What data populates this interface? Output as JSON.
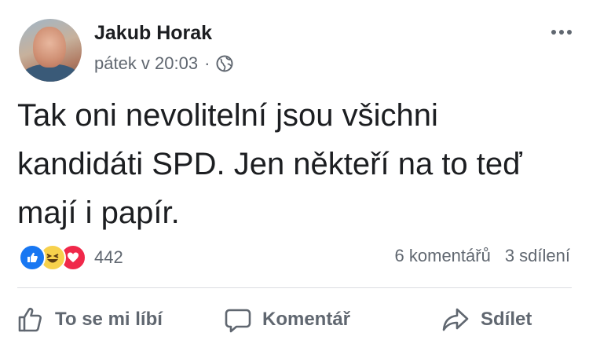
{
  "post": {
    "author": "Jakub Horak",
    "timestamp": "pátek v 20:03",
    "separator": "·",
    "privacy_icon": "globe-icon",
    "text": "Tak oni nevolitelní jsou všichni kandidáti SPD. Jen někteří na to teď mají i papír."
  },
  "reactions": {
    "types": [
      "like-icon",
      "haha-icon",
      "love-icon"
    ],
    "count": "442"
  },
  "stats": {
    "comments": "6 komentářů",
    "shares": "3 sdílení"
  },
  "actions": {
    "like_label": "To se mi líbí",
    "comment_label": "Komentář",
    "share_label": "Sdílet"
  },
  "colors": {
    "text": "#1c1e21",
    "secondary": "#606770",
    "like_blue": "#1877f2",
    "haha_yellow": "#f7d14c",
    "love_red": "#f0284a",
    "divider": "#dadde1"
  }
}
